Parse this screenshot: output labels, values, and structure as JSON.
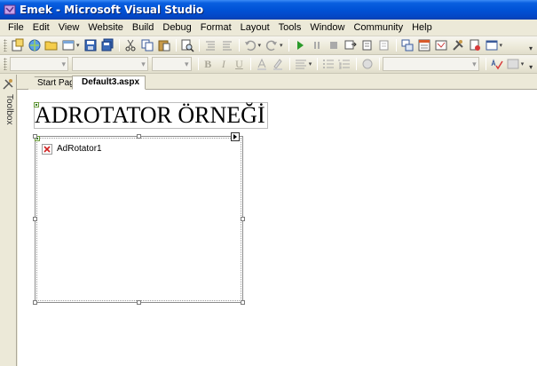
{
  "window": {
    "title": "Emek - Microsoft Visual Studio"
  },
  "menu": {
    "items": [
      "File",
      "Edit",
      "View",
      "Website",
      "Build",
      "Debug",
      "Format",
      "Layout",
      "Tools",
      "Window",
      "Community",
      "Help"
    ]
  },
  "toolbar_formatting": {
    "bold": "B",
    "italic": "I",
    "underline": "U"
  },
  "toolbox": {
    "label": "Toolbox"
  },
  "tabs": [
    {
      "label": "Start Page",
      "active": false
    },
    {
      "label": "Default3.aspx",
      "active": true
    }
  ],
  "design": {
    "heading": "ADROTATOR ÖRNEĞİ",
    "adrotator_label": "AdRotator1"
  },
  "colors": {
    "titlebar": "#0052d6",
    "chrome": "#ece9d8",
    "design_surface": "#ffffff"
  }
}
